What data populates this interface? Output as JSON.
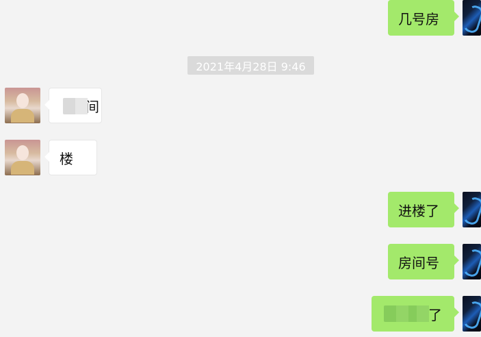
{
  "timestamp": "2021年4月28日 9:46",
  "messages": [
    {
      "side": "right",
      "text": "几号房"
    },
    {
      "side": "left",
      "text": "间",
      "redacted": true
    },
    {
      "side": "left",
      "text": "楼"
    },
    {
      "side": "right",
      "text": "进楼了"
    },
    {
      "side": "right",
      "text": "房间号"
    },
    {
      "side": "right",
      "text": "了",
      "redacted": true
    }
  ]
}
